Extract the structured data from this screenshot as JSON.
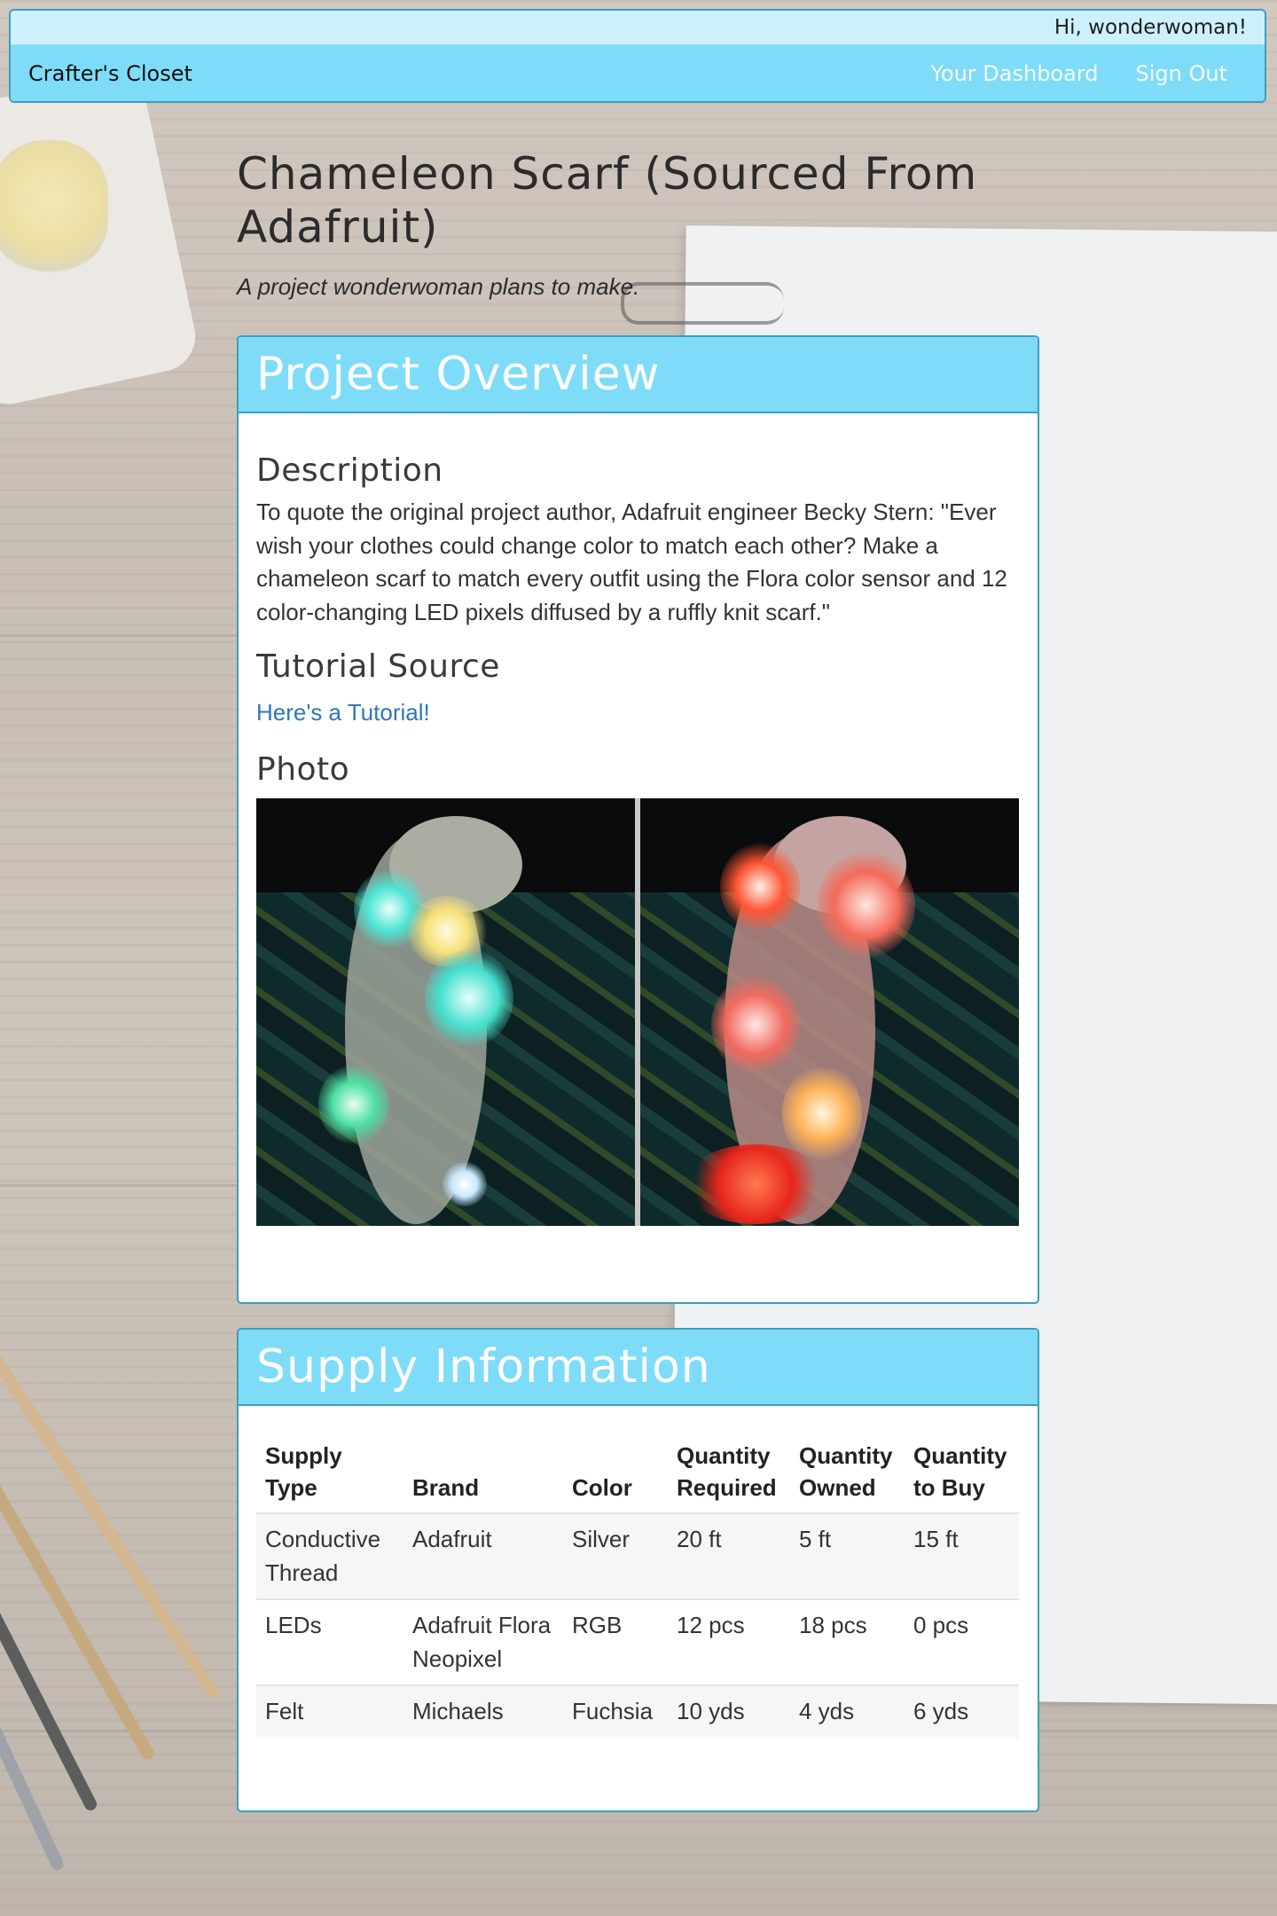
{
  "navbar": {
    "greeting": "Hi, wonderwoman!",
    "brand": "Crafter's Closet",
    "links": [
      "Your Dashboard",
      "Sign Out"
    ]
  },
  "header": {
    "title": "Chameleon Scarf (Sourced From Adafruit)",
    "subtitle": "A project wonderwoman plans to make."
  },
  "overview": {
    "heading": "Project Overview",
    "description_heading": "Description",
    "description": "To quote the original project author, Adafruit engineer Becky Stern: \"Ever wish your clothes could change color to match each other? Make a chameleon scarf to match every outfit using the Flora color sensor and 12 color-changing LED pixels diffused by a ruffly knit scarf.\"",
    "tutorial_heading": "Tutorial Source",
    "tutorial_link": "Here's a Tutorial!",
    "photo_heading": "Photo"
  },
  "supply": {
    "heading": "Supply Information",
    "columns": [
      "Supply Type",
      "Brand",
      "Color",
      "Quantity Required",
      "Quantity Owned",
      "Quantity to Buy"
    ],
    "rows": [
      [
        "Conductive Thread",
        "Adafruit",
        "Silver",
        "20 ft",
        "5 ft",
        "15 ft"
      ],
      [
        "LEDs",
        "Adafruit Flora Neopixel",
        "RGB",
        "12 pcs",
        "18 pcs",
        "0 pcs"
      ],
      [
        "Felt",
        "Michaels",
        "Fuchsia",
        "10 yds",
        "4 yds",
        "6 yds"
      ]
    ]
  },
  "colors": {
    "accent": "#7fdcf9",
    "accent_light": "#cdf1fc",
    "border": "#3aa0bd",
    "link": "#2f77b8"
  }
}
